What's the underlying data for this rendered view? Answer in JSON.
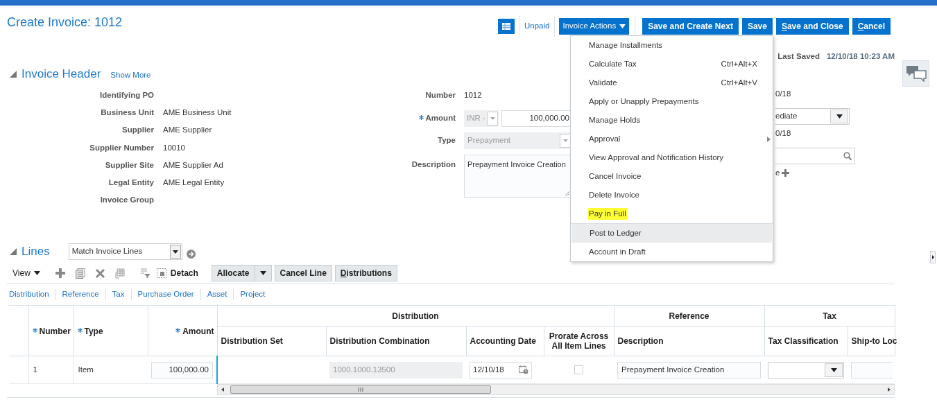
{
  "page_title": "Create Invoice: 1012",
  "toolbar": {
    "status_link": "Unpaid",
    "actions_button": "Invoice Actions",
    "buttons": [
      {
        "label": "Save and Create Next"
      },
      {
        "label": "Save"
      },
      {
        "underlined": "S",
        "after": "ave and Close"
      },
      {
        "underlined": "C",
        "after": "ancel"
      }
    ]
  },
  "last_saved": {
    "label": "Last Saved",
    "value": "12/10/18 10:23 AM"
  },
  "invoice_header": {
    "title": "Invoice Header",
    "expanded": true,
    "show_more": "Show More",
    "left_fields": [
      {
        "label": "Identifying PO"
      },
      {
        "label": "Business Unit",
        "value": "AME Business Unit"
      },
      {
        "label": "Supplier",
        "value": "AME Supplier"
      },
      {
        "label": "Supplier Number",
        "value": "10010"
      },
      {
        "label": "Supplier Site",
        "value": "AME Supplier Ad"
      },
      {
        "label": "Legal Entity",
        "value": "AME Legal Entity"
      },
      {
        "label": "Invoice Group"
      }
    ],
    "middle_fields": [
      {
        "kind": "text",
        "label": "Number",
        "value": "1012",
        "required": false
      },
      {
        "kind": "currency_amount",
        "label": "Amount",
        "required": true,
        "currency": "INR -",
        "currency_disabled": true,
        "value": "100,000.00"
      },
      {
        "kind": "select",
        "label": "Type",
        "value": "Prepayment",
        "required": false,
        "disabled": true
      },
      {
        "kind": "textarea",
        "label": "Description",
        "value": "Prepayment Invoice Creation",
        "required": false
      }
    ],
    "right_fragments": [
      {
        "kind": "text",
        "value": "0/18"
      },
      {
        "kind": "select",
        "value": "ediate"
      },
      {
        "kind": "text",
        "value": "0/18"
      },
      {
        "kind": "search"
      },
      {
        "kind": "add",
        "value": "e"
      }
    ]
  },
  "actions_menu": {
    "groups": [
      {
        "items": [
          {
            "label": "Manage Installments",
            "hovered": false,
            "highlighted": false,
            "submenu": false
          },
          {
            "label": "Calculate Tax",
            "shortcut": "Ctrl+Alt+X",
            "hovered": false,
            "highlighted": false,
            "submenu": false
          },
          {
            "label": "Validate",
            "shortcut": "Ctrl+Alt+V",
            "hovered": false,
            "highlighted": false,
            "submenu": false
          },
          {
            "label": "Apply or Unapply Prepayments",
            "hovered": false,
            "highlighted": false,
            "submenu": false
          },
          {
            "label": "Manage Holds",
            "hovered": false,
            "highlighted": false,
            "submenu": false
          },
          {
            "label": "Approval",
            "hovered": false,
            "highlighted": false,
            "submenu": true
          },
          {
            "label": "View Approval and Notification History",
            "hovered": false,
            "highlighted": false,
            "submenu": false
          },
          {
            "label": "Cancel Invoice",
            "hovered": false,
            "highlighted": false,
            "submenu": false
          },
          {
            "label": "Delete Invoice",
            "hovered": false,
            "highlighted": false,
            "submenu": false
          },
          {
            "label": "Pay in Full",
            "hovered": false,
            "highlighted": true,
            "submenu": false
          }
        ]
      },
      {
        "items": [
          {
            "label": "Post to Ledger",
            "hovered": true,
            "highlighted": false,
            "submenu": false
          },
          {
            "label": "Account in Draft",
            "hovered": false,
            "highlighted": false,
            "submenu": false
          }
        ]
      }
    ]
  },
  "lines": {
    "title": "Lines",
    "expanded": true,
    "match_select": "Match Invoice Lines",
    "view_menu": "View",
    "detach": "Detach",
    "buttons": [
      {
        "label": "Allocate",
        "split": true
      },
      {
        "label": "Cancel Line",
        "split": false
      },
      {
        "underlined": "D",
        "after": "istributions",
        "split": false
      }
    ],
    "tabs": [
      "Distribution",
      "Reference",
      "Tax",
      "Purchase Order",
      "Asset",
      "Project"
    ],
    "table": {
      "frozen_columns": [
        {
          "label": "Number",
          "required": true
        },
        {
          "label": "Type",
          "required": true
        },
        {
          "label": "Amount",
          "required": true
        }
      ],
      "groups": [
        {
          "label": "Distribution",
          "columns": [
            {
              "label": "Distribution Set",
              "required": false
            },
            {
              "label": "Distribution Combination",
              "required": false
            },
            {
              "label": "Accounting Date",
              "required": false
            },
            {
              "label": "Prorate Across All Item Lines",
              "required": false
            }
          ]
        },
        {
          "label": "Reference",
          "columns": [
            {
              "label": "Description",
              "required": false
            }
          ]
        },
        {
          "label": "Tax",
          "columns": [
            {
              "label": "Tax Classification",
              "required": false
            },
            {
              "label": "Ship-to Loc",
              "required": false
            }
          ]
        }
      ],
      "rows": [
        {
          "cells": [
            {
              "kind": "text",
              "value": "1"
            },
            {
              "kind": "text",
              "value": "Item"
            },
            {
              "kind": "input",
              "value": "100,000.00"
            },
            {
              "kind": "empty"
            },
            {
              "kind": "disabled_input",
              "value": "1000.1000.13500"
            },
            {
              "kind": "date",
              "value": "12/10/18"
            },
            {
              "kind": "checkbox",
              "checked": false
            },
            {
              "kind": "input",
              "value": "Prepayment Invoice Creation"
            },
            {
              "kind": "select"
            },
            {
              "kind": "input"
            }
          ]
        }
      ]
    }
  }
}
